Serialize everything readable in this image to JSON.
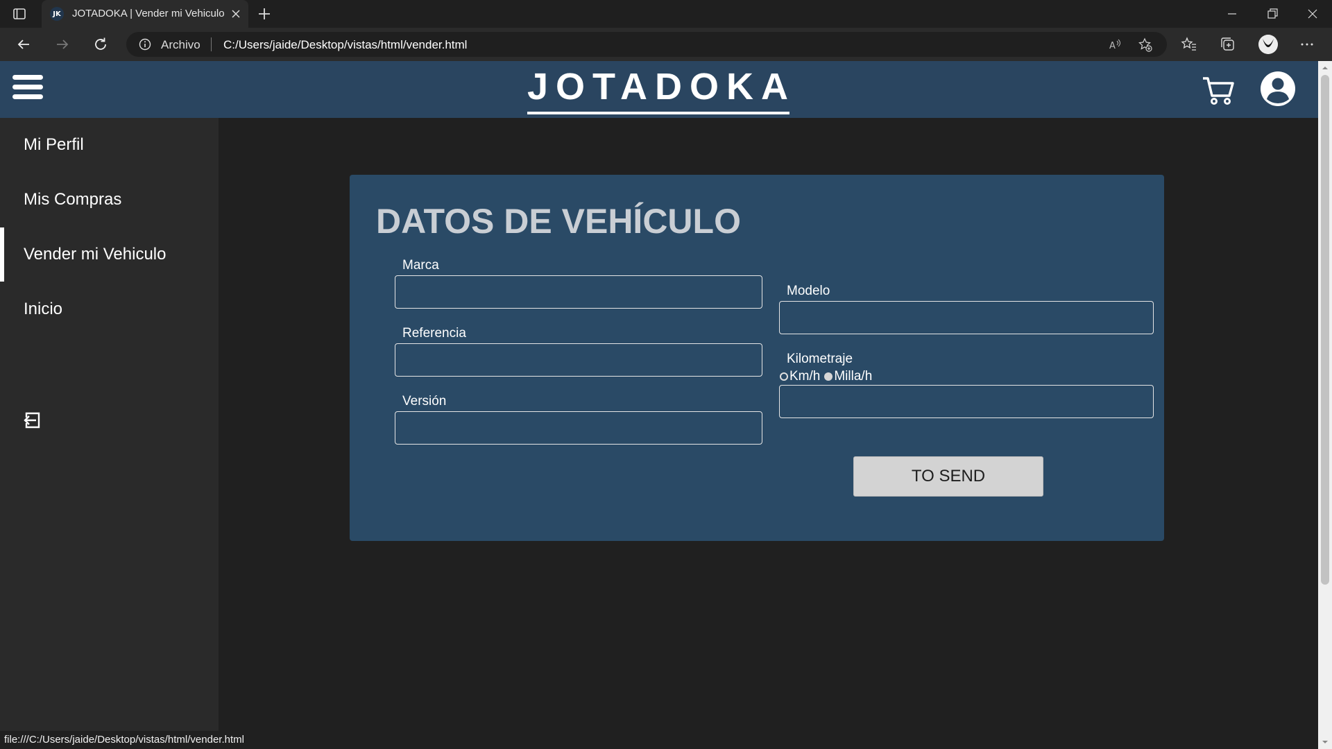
{
  "browser": {
    "tab": {
      "favicon_text": "JK",
      "title": "JOTADOKA | Vender mi Vehiculo"
    },
    "address": {
      "scheme_label": "Archivo",
      "url": "C:/Users/jaide/Desktop/vistas/html/vender.html"
    },
    "status_url": "file:///C:/Users/jaide/Desktop/vistas/html/vender.html"
  },
  "header": {
    "brand": "JOTADOKA"
  },
  "sidebar": {
    "items": [
      {
        "label": "Mi Perfil"
      },
      {
        "label": "Mis Compras"
      },
      {
        "label": "Vender mi Vehiculo",
        "active": true
      },
      {
        "label": "Inicio"
      }
    ]
  },
  "form": {
    "title": "DATOS DE VEHÍCULO",
    "fields": {
      "marca": {
        "label": "Marca",
        "value": ""
      },
      "referencia": {
        "label": "Referencia",
        "value": ""
      },
      "version": {
        "label": "Versión",
        "value": ""
      },
      "modelo": {
        "label": "Modelo",
        "value": ""
      },
      "kilometraje": {
        "label": "Kilometraje",
        "value": ""
      }
    },
    "units": {
      "kmh": "Km/h",
      "millah": "Milla/h",
      "selected": "Milla/h"
    },
    "submit_label": "TO SEND"
  },
  "colors": {
    "header_bg": "#2a4560",
    "card_bg": "#2a4a66",
    "sidebar_bg": "#2a2a2a",
    "page_bg": "#202020"
  }
}
